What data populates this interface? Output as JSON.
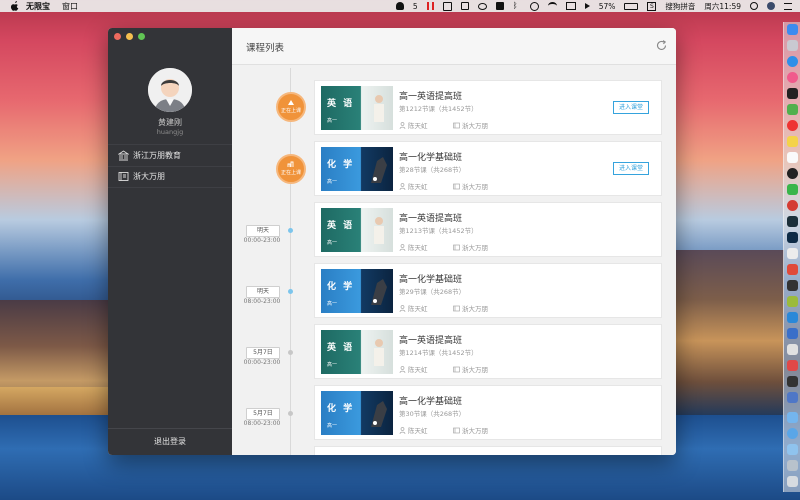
{
  "menubar": {
    "app_name": "无限宝",
    "menu_window": "窗口",
    "status_count": "5",
    "battery": "57%",
    "input_method": "搜狗拼音",
    "clock": "周六11:59"
  },
  "sidebar": {
    "user_name": "黄建刚",
    "user_id": "huangjg",
    "items": [
      {
        "label": "浙江万朋教育"
      },
      {
        "label": "浙大万朋"
      }
    ],
    "logout": "退出登录"
  },
  "main": {
    "title": "课程列表"
  },
  "timeline": [
    {
      "badge": "正在上课"
    },
    {
      "badge": "正在上课"
    },
    {
      "date": "明天",
      "time": "00:00-23:00"
    },
    {
      "date": "明天",
      "time": "08:00-23:00"
    },
    {
      "date": "5月7日",
      "time": "00:00-23:00"
    },
    {
      "date": "5月7日",
      "time": "08:00-23:00"
    }
  ],
  "courses": [
    {
      "title": "高一英语提高班",
      "sub": "第1212节课（共1452节）",
      "teacher": "陈天虹",
      "school": "浙大万朋",
      "subject": "英 语",
      "grade": "高一",
      "button": "进入课堂"
    },
    {
      "title": "高一化学基础班",
      "sub": "第28节课（共268节）",
      "teacher": "陈天虹",
      "school": "浙大万朋",
      "subject": "化 学",
      "grade": "高一",
      "button": "进入课堂"
    },
    {
      "title": "高一英语提高班",
      "sub": "第1213节课（共1452节）",
      "teacher": "陈天虹",
      "school": "浙大万朋",
      "subject": "英 语",
      "grade": "高一"
    },
    {
      "title": "高一化学基础班",
      "sub": "第29节课（共268节）",
      "teacher": "陈天虹",
      "school": "浙大万朋",
      "subject": "化 学",
      "grade": "高一"
    },
    {
      "title": "高一英语提高班",
      "sub": "第1214节课（共1452节）",
      "teacher": "陈天虹",
      "school": "浙大万朋",
      "subject": "英 语",
      "grade": "高一"
    },
    {
      "title": "高一化学基础班",
      "sub": "第30节课（共268节）",
      "teacher": "陈天虹",
      "school": "浙大万朋",
      "subject": "化 学",
      "grade": "高一"
    }
  ],
  "colors": {
    "accent": "#35a3dd",
    "live_badge": "#f0933a",
    "sidebar_bg": "#333438"
  }
}
